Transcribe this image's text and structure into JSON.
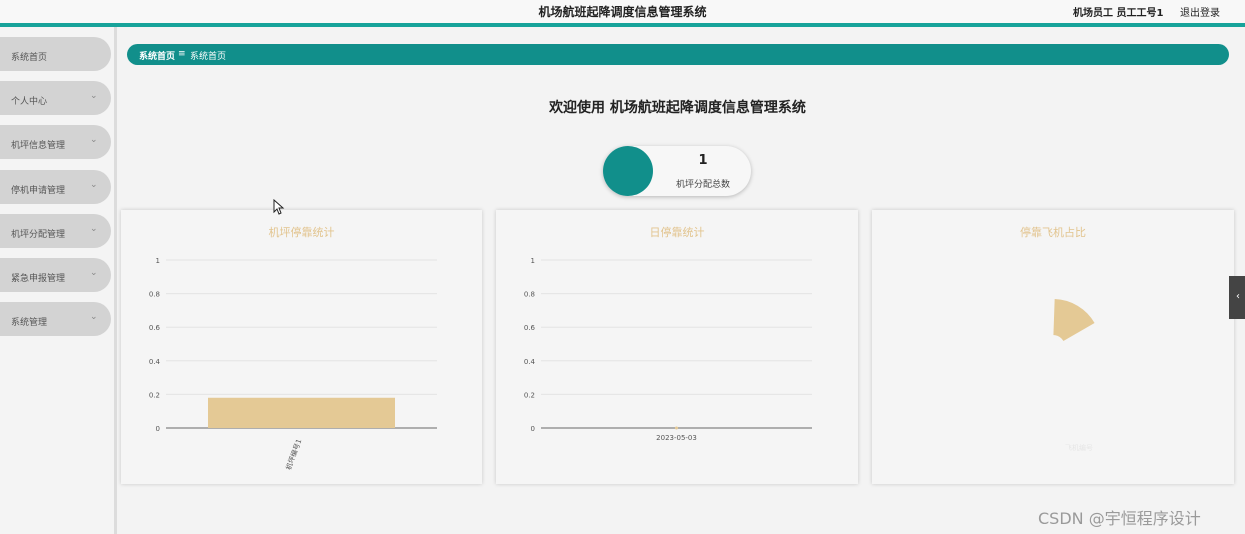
{
  "header": {
    "title": "机场航班起降调度信息管理系统",
    "user": "机场员工 员工工号1",
    "logout": "退出登录"
  },
  "sidebar": {
    "items": [
      {
        "label": "系统首页",
        "has_submenu": false
      },
      {
        "label": "个人中心",
        "has_submenu": true
      },
      {
        "label": "机坪信息管理",
        "has_submenu": true
      },
      {
        "label": "停机申请管理",
        "has_submenu": true
      },
      {
        "label": "机坪分配管理",
        "has_submenu": true
      },
      {
        "label": "紧急申报管理",
        "has_submenu": true
      },
      {
        "label": "系统管理",
        "has_submenu": true
      }
    ],
    "chevron": "⌄"
  },
  "breadcrumb": {
    "home": "系统首页",
    "separator": "≡",
    "current": "系统首页"
  },
  "welcome": "欢迎使用 机场航班起降调度信息管理系统",
  "stat": {
    "value": "1",
    "label": "机坪分配总数"
  },
  "colors": {
    "accent": "#118f8b",
    "chart_bar": "#e4c995",
    "chart_title": "#e2c48e"
  },
  "panels": {
    "apron_title": "机坪停靠统计",
    "daily_title": "日停靠统计",
    "pie_title": "停靠飞机占比"
  },
  "chart_data": [
    {
      "type": "bar",
      "title": "机坪停靠统计",
      "categories": [
        "机坪编号1"
      ],
      "values": [
        0.18
      ],
      "ylim": [
        0,
        1
      ],
      "yticks": [
        "0",
        "0.2",
        "0.4",
        "0.6",
        "0.8",
        "1"
      ],
      "grid": true
    },
    {
      "type": "line",
      "title": "日停靠统计",
      "categories": [
        "2023-05-03"
      ],
      "values": [
        0
      ],
      "ylim": [
        0,
        1
      ],
      "yticks": [
        "0",
        "0.2",
        "0.4",
        "0.6",
        "0.8",
        "1"
      ],
      "grid": true
    },
    {
      "type": "pie",
      "title": "停靠飞机占比",
      "slices": [
        {
          "label": "飞机编号",
          "value": 1
        }
      ]
    }
  ],
  "collapse_icon": "‹",
  "watermark": "CSDN @宇恒程序设计"
}
